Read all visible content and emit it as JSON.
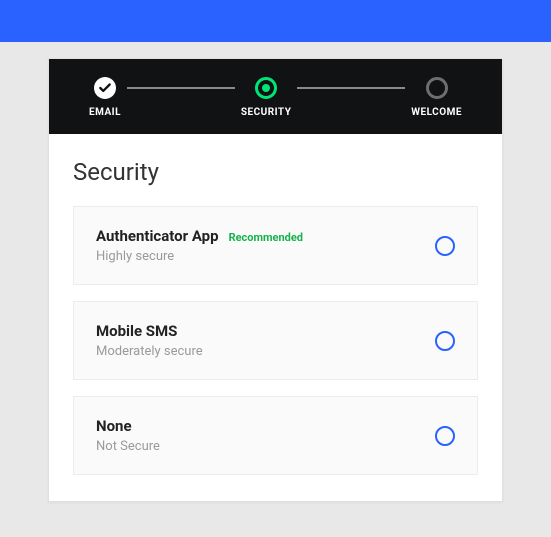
{
  "stepper": {
    "steps": [
      {
        "label": "EMAIL",
        "state": "done"
      },
      {
        "label": "SECURITY",
        "state": "active"
      },
      {
        "label": "WELCOME",
        "state": "upcoming"
      }
    ]
  },
  "page": {
    "title": "Security"
  },
  "options": [
    {
      "title": "Authenticator App",
      "badge": "Recommended",
      "subtitle": "Highly secure"
    },
    {
      "title": "Mobile SMS",
      "badge": "",
      "subtitle": "Moderately secure"
    },
    {
      "title": "None",
      "badge": "",
      "subtitle": "Not Secure"
    }
  ]
}
